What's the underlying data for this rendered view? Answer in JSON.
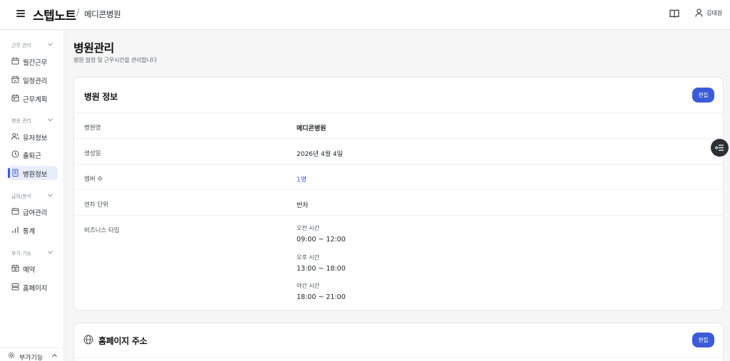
{
  "header": {
    "brand": "스텝노트",
    "separator": "/",
    "breadcrumb": "메디콘병원",
    "user_name": "김대원"
  },
  "sidebar": {
    "sections": [
      {
        "title": "근무 관리",
        "items": [
          {
            "label": "월간근무",
            "icon": "calendar-icon"
          },
          {
            "label": "일정관리",
            "icon": "calendar-edit-icon"
          },
          {
            "label": "근무계획",
            "icon": "calendar-plan-icon"
          }
        ]
      },
      {
        "title": "병원 관리",
        "items": [
          {
            "label": "유저정보",
            "icon": "users-icon"
          },
          {
            "label": "출퇴근",
            "icon": "clock-icon"
          },
          {
            "label": "병원정보",
            "icon": "building-icon",
            "active": true
          }
        ]
      },
      {
        "title": "급여/분석",
        "items": [
          {
            "label": "급여관리",
            "icon": "wallet-icon"
          },
          {
            "label": "통계",
            "icon": "bar-chart-icon"
          }
        ]
      },
      {
        "title": "부가 기능",
        "items": [
          {
            "label": "예약",
            "icon": "calendar-check-icon"
          },
          {
            "label": "홈페이지",
            "icon": "layout-icon"
          }
        ]
      }
    ],
    "bottom_label": "부가기능"
  },
  "page": {
    "title": "병원관리",
    "subtitle": "병원 설정 및 근무시간을 관리합니다"
  },
  "hospital_card": {
    "title": "병원 정보",
    "edit_label": "편집",
    "rows": [
      {
        "key": "병원명",
        "value": "메디콘병원"
      },
      {
        "key": "생성일",
        "value": "2026년 4월 4일"
      },
      {
        "key": "멤버 수",
        "value": "1명"
      },
      {
        "key": "연차 단위",
        "value": "반차"
      },
      {
        "key": "비즈니스 타임"
      }
    ],
    "business_time": [
      {
        "label": "오전 시간",
        "time": "09:00 ~ 12:00"
      },
      {
        "label": "오후 시간",
        "time": "13:00 ~ 18:00"
      },
      {
        "label": "야간 시간",
        "time": "18:00 ~ 21:00"
      }
    ]
  },
  "homepage_card": {
    "title": "홈페이지 주소",
    "edit_label": "편집"
  },
  "colors": {
    "accent": "#3b5bd9",
    "active_bg": "#e8edfb",
    "fab_bg": "#2b2f36"
  }
}
